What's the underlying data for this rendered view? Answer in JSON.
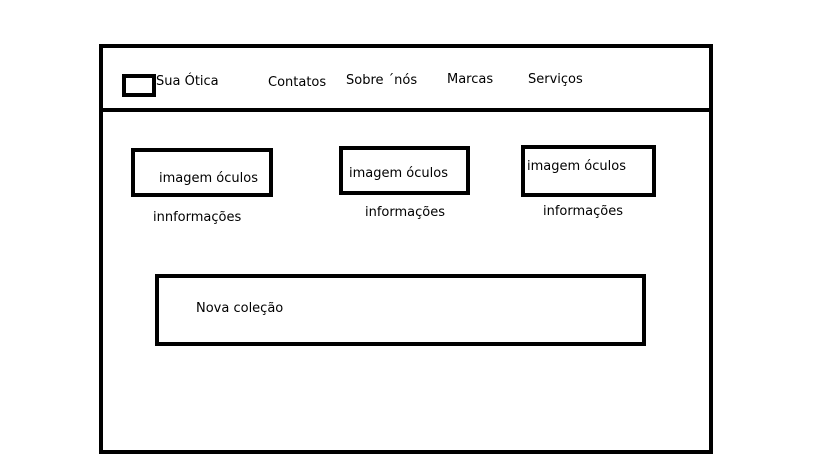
{
  "header": {
    "brand": "Sua Ótica",
    "nav": [
      "Contatos",
      "Sobre ´nós",
      "Marcas",
      "Serviços"
    ]
  },
  "products": [
    {
      "image_label": "imagem óculos",
      "info": "innformações"
    },
    {
      "image_label": "imagem óculos",
      "info": "informações"
    },
    {
      "image_label": "imagem óculos",
      "info": "informações"
    }
  ],
  "banner": {
    "label": "Nova coleção"
  }
}
